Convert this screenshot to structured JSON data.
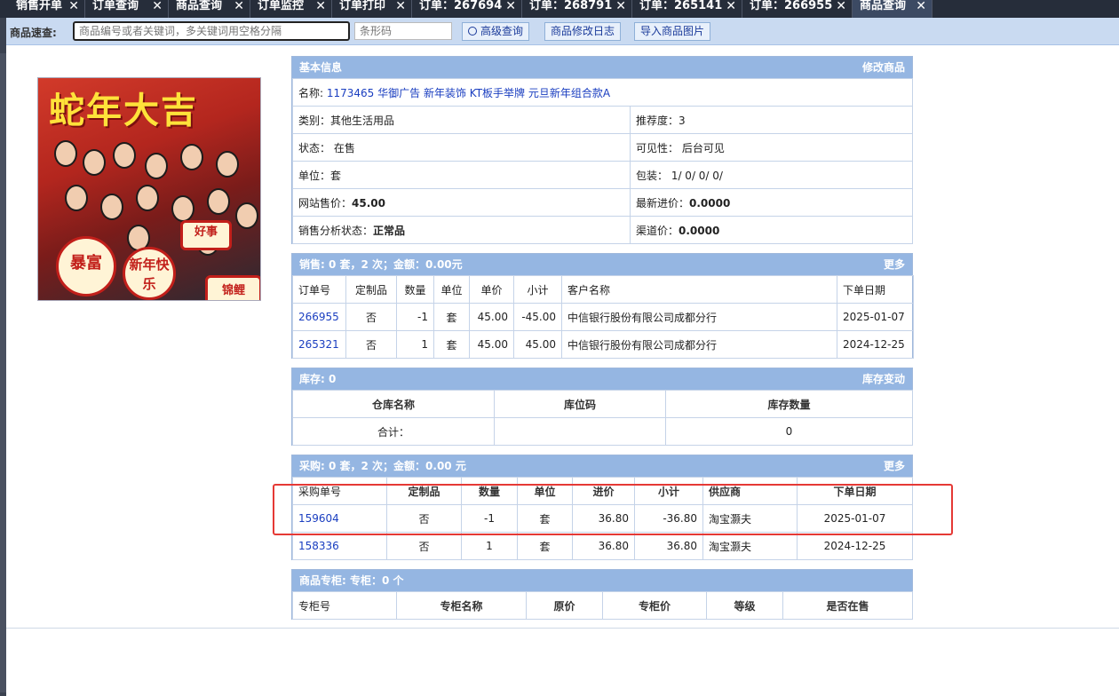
{
  "tabs": [
    {
      "label": "销售开单",
      "active": false
    },
    {
      "label": "订单查询",
      "active": false
    },
    {
      "label": "商品查询",
      "active": false
    },
    {
      "label": "订单监控",
      "active": false
    },
    {
      "label": "订单打印",
      "active": false
    },
    {
      "label": "订单：267694",
      "active": false
    },
    {
      "label": "订单：268791",
      "active": false
    },
    {
      "label": "订单：265141",
      "active": false
    },
    {
      "label": "订单：266955",
      "active": false
    },
    {
      "label": "商品查询",
      "active": true
    }
  ],
  "toolbar": {
    "label": "商品速查:",
    "search_placeholder": "商品编号或者关键词，多关键词用空格分隔",
    "barcode_placeholder": "条形码",
    "advanced": "高级查询",
    "log": "商品修改日志",
    "import": "导入商品图片"
  },
  "image": {
    "banner": "蛇年大吉",
    "signs": [
      "暴富",
      "新年快乐",
      "好事",
      "锦鲤"
    ]
  },
  "basic": {
    "title": "基本信息",
    "action": "修改商品",
    "name_label": "名称:",
    "name_value": "1173465 华御广告 新年装饰 KT板手举牌 元旦新年组合款A",
    "category": "类别：其他生活用品",
    "recommend": "推荐度：3",
    "status": "状态：  在售",
    "visibility": "可见性：  后台可见",
    "unit": "单位：套",
    "pack": "包装：  1/ 0/ 0/ 0/",
    "price_label": "网站售价：",
    "price_value": "45.00",
    "latest_label": "最新进价：",
    "latest_value": "0.0000",
    "analysis_label": "销售分析状态：",
    "analysis_value": "正常品",
    "channel_label": "渠道价：",
    "channel_value": "0.0000"
  },
  "sales": {
    "title": "销售:  0 套，2 次；金额：0.00元",
    "more": "更多",
    "columns": [
      "订单号",
      "定制品",
      "数量",
      "单位",
      "单价",
      "小计",
      "客户名称",
      "下单日期"
    ],
    "rows": [
      [
        "266955",
        "否",
        "-1",
        "套",
        "45.00",
        "-45.00",
        "中信银行股份有限公司成都分行",
        "2025-01-07"
      ],
      [
        "265321",
        "否",
        "1",
        "套",
        "45.00",
        "45.00",
        "中信银行股份有限公司成都分行",
        "2024-12-25"
      ]
    ]
  },
  "stock": {
    "title": "库存:  0",
    "action": "库存变动",
    "columns": [
      "仓库名称",
      "库位码",
      "库存数量"
    ],
    "total_row": [
      "合计：",
      "",
      "0"
    ]
  },
  "purchase": {
    "title": "采购:  0 套，2 次；金额：0.00 元",
    "more": "更多",
    "columns": [
      "采购单号",
      "定制品",
      "数量",
      "单位",
      "进价",
      "小计",
      "供应商",
      "下单日期"
    ],
    "rows": [
      [
        "159604",
        "否",
        "-1",
        "套",
        "36.80",
        "-36.80",
        "淘宝灏夫",
        "2025-01-07"
      ],
      [
        "158336",
        "否",
        "1",
        "套",
        "36.80",
        "36.80",
        "淘宝灏夫",
        "2024-12-25"
      ]
    ]
  },
  "counter": {
    "title": "商品专柜:  专柜：0 个",
    "columns": [
      "专柜号",
      "专柜名称",
      "原价",
      "专柜价",
      "等级",
      "是否在售"
    ]
  },
  "colors": {
    "panel_header": "#95b6e2",
    "toolbar": "#c9daf1",
    "tabbar": "#262d3a",
    "link": "#1a3ec0",
    "highlight": "#e53935"
  }
}
